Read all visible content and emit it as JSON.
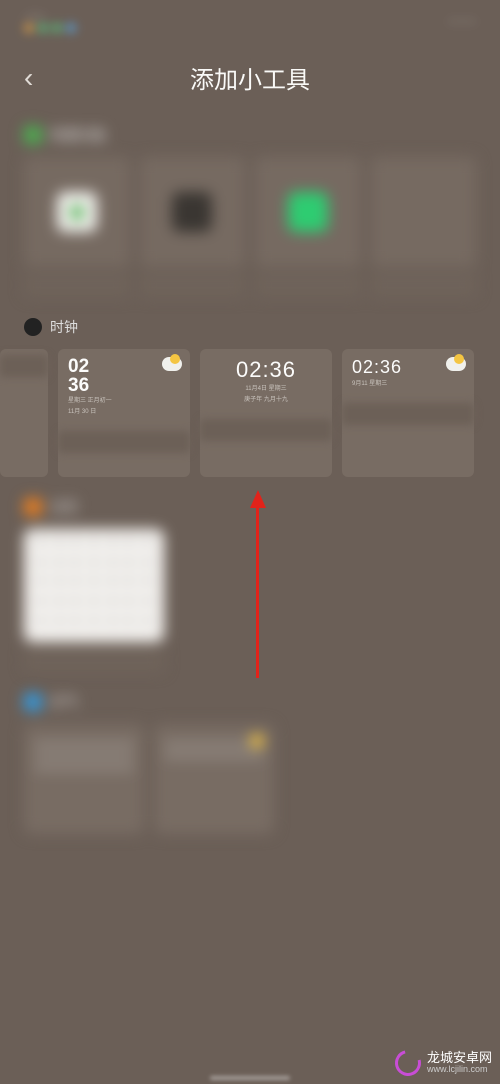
{
  "statusBar": {
    "left": "",
    "right": ""
  },
  "header": {
    "title": "添加小工具"
  },
  "sections": {
    "quick": {
      "title": "快捷功能"
    },
    "clock": {
      "title": "时钟",
      "widgets": [
        {
          "time_top": "02",
          "time_bottom": "36",
          "sub1": "星期三 正月初一",
          "sub2": "11月 30 日"
        },
        {
          "time": "02:36",
          "sub1": "11月4日 星期三",
          "sub2": "庚子年 九月十九"
        },
        {
          "time": "02:36",
          "sub": "9月11 星期三"
        }
      ]
    },
    "calendar": {
      "title": "日历"
    },
    "weather": {
      "title": "天气"
    }
  },
  "watermark": {
    "brand": "龙城安卓网",
    "url": "www.lcjilin.com"
  }
}
